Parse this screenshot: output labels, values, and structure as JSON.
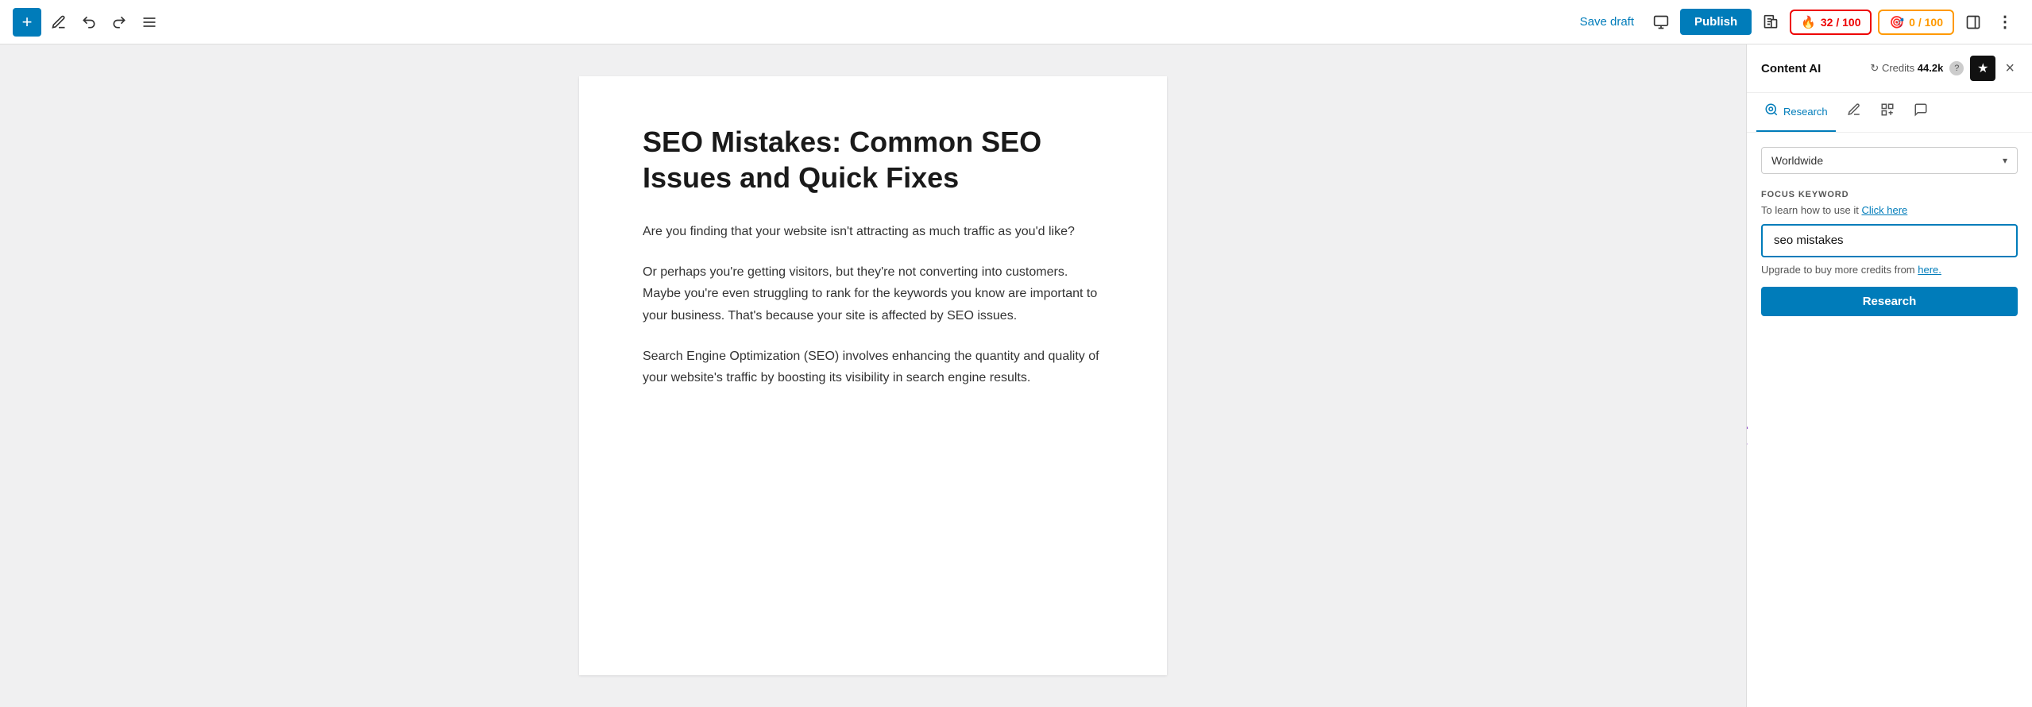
{
  "toolbar": {
    "add_label": "+",
    "save_draft_label": "Save draft",
    "publish_label": "Publish",
    "score_red_label": "32 / 100",
    "score_orange_label": "0 / 100"
  },
  "panel": {
    "title": "Content AI",
    "credits_label": "Credits",
    "credits_value": "44.2k",
    "close_label": "×",
    "tabs": [
      {
        "id": "research",
        "label": "Research",
        "icon": "👁"
      },
      {
        "id": "write",
        "label": "",
        "icon": "✏"
      },
      {
        "id": "seo",
        "label": "",
        "icon": "📋"
      },
      {
        "id": "chat",
        "label": "",
        "icon": "💬"
      }
    ],
    "active_tab": "research",
    "worldwide_label": "Worldwide",
    "focus_keyword": {
      "section_label": "FOCUS KEYWORD",
      "description": "To learn how to use it",
      "link_text": "Click here",
      "input_value": "seo mistakes",
      "input_placeholder": "seo mistakes",
      "upgrade_text": "Upgrade to buy more credits from",
      "upgrade_link_text": "here.",
      "research_btn_label": "Research"
    }
  },
  "editor": {
    "title": "SEO Mistakes: Common SEO Issues and Quick Fixes",
    "paragraphs": [
      "Are you finding that your website isn't attracting as much traffic as you'd like?",
      "Or perhaps you're getting visitors, but they're not converting into customers. Maybe you're even struggling to rank for the keywords you know are important to your business. That's because your site is affected by SEO issues.",
      "Search Engine Optimization (SEO) involves enhancing the quantity and quality of your website's traffic by boosting its visibility in search engine results."
    ]
  }
}
